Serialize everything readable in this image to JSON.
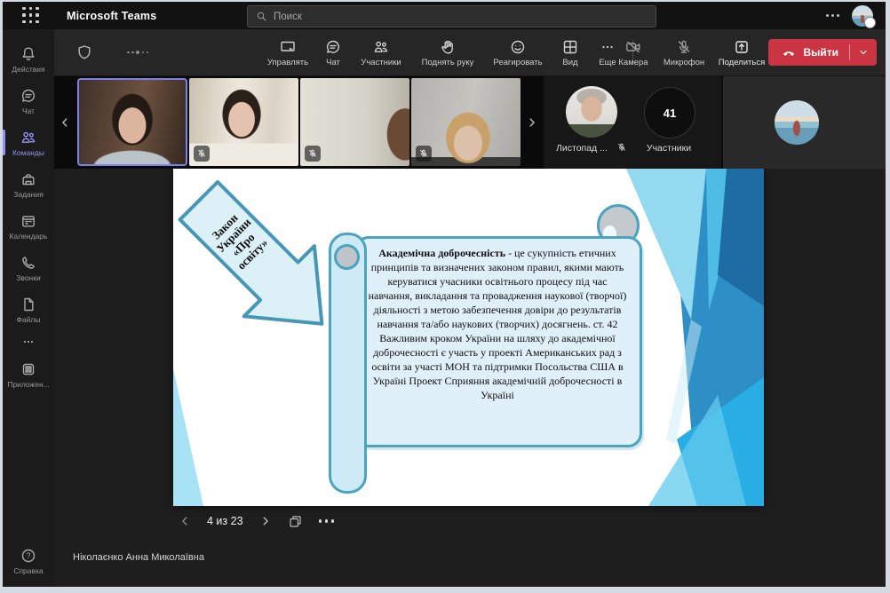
{
  "app": {
    "title": "Microsoft Teams",
    "search_placeholder": "Поиск"
  },
  "sidebar": {
    "items": [
      {
        "label": "Действия",
        "icon": "bell-icon"
      },
      {
        "label": "Чат",
        "icon": "chat-bubble-icon"
      },
      {
        "label": "Команды",
        "icon": "teams-people-icon",
        "active": true
      },
      {
        "label": "Задания",
        "icon": "backpack-icon"
      },
      {
        "label": "Календарь",
        "icon": "calendar-icon"
      },
      {
        "label": "Звонки",
        "icon": "phone-icon"
      },
      {
        "label": "Файлы",
        "icon": "file-icon"
      },
      {
        "label": "Приложен...",
        "icon": "apps-grid-icon"
      }
    ],
    "help_label": "Справка",
    "help_glyph": "?"
  },
  "toolbar": {
    "buttons": [
      {
        "label": "Управлять",
        "icon": "screen-manage-icon"
      },
      {
        "label": "Чат",
        "icon": "meeting-chat-icon"
      },
      {
        "label": "Участники",
        "icon": "participants-icon"
      },
      {
        "label": "Поднять руку",
        "icon": "raise-hand-icon"
      },
      {
        "label": "Реагировать",
        "icon": "react-smiley-icon"
      },
      {
        "label": "Вид",
        "icon": "view-grid-icon"
      },
      {
        "label": "Еще",
        "icon": "more-ellipsis-icon"
      }
    ],
    "device_buttons": [
      {
        "label": "Камера",
        "icon": "camera-off-icon"
      },
      {
        "label": "Микрофон",
        "icon": "mic-off-icon"
      },
      {
        "label": "Поделиться",
        "icon": "share-tray-icon"
      }
    ],
    "leave_label": "Выйти"
  },
  "strip": {
    "overflow_name": "Листопад ...",
    "count": "41",
    "count_label": "Участники"
  },
  "slide": {
    "arrow": {
      "lines": [
        "Закон",
        "України",
        "«Про",
        "освіту»"
      ]
    },
    "scroll": {
      "lead": "Академічна доброчесність",
      "text1": " - це сукупність етичних принципів та визначених законом правил, якими мають керуватися учасники освітнього процесу під час навчання, викладання та провадження наукової (творчої) діяльності з метою забезпечення довіри до результатів навчання та/або наукових (творчих) досягнень. ст. 42",
      "text2": "Важливим кроком України на шляху до академічної доброчесності є участь у проекті Американських рад з освіти за участі МОН та підтримки Посольства США в Україні Проект Сприяння академічній доброчесності в Україні"
    }
  },
  "nav": {
    "position": "4 из 23"
  },
  "presenter": {
    "name": "Ніколаєнко Анна Миколаївна"
  },
  "colors": {
    "accent_purple": "#8f95f0",
    "active_tile_border": "#7b82e9",
    "leave_red": "#cb3543",
    "scroll_fill": "#dff0fa",
    "scroll_stroke": "#4aa3bf",
    "slide_design_blue": "#2e8ec6",
    "slide_design_cyan": "#28ade4"
  }
}
